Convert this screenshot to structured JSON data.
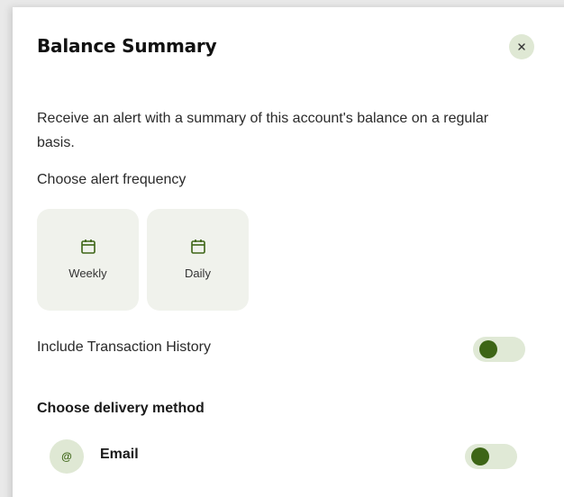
{
  "dialog": {
    "title": "Balance Summary",
    "close_icon": "close-icon",
    "description": "Receive an alert with a summary of this account's balance on a regular basis."
  },
  "frequency": {
    "label": "Choose alert frequency",
    "options": [
      {
        "label": "Weekly",
        "icon": "calendar-icon"
      },
      {
        "label": "Daily",
        "icon": "calendar-icon"
      }
    ]
  },
  "transaction_history": {
    "label": "Include Transaction History",
    "enabled": false
  },
  "delivery": {
    "label": "Choose delivery method",
    "methods": [
      {
        "label": "Email",
        "icon_glyph": "@",
        "icon": "at-sign-icon",
        "enabled": false
      }
    ]
  },
  "colors": {
    "accent": "#3d6516",
    "accent_light": "#dfe8d4",
    "card_bg": "#f0f2ec"
  }
}
